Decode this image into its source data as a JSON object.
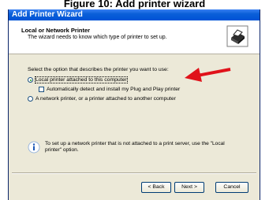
{
  "caption": "Figure 10: Add printer wizard",
  "window": {
    "title": "Add Printer Wizard"
  },
  "header": {
    "title": "Local or Network Printer",
    "subtitle": "The wizard needs to know which type of printer to set up.",
    "icon": "printer-icon"
  },
  "body": {
    "prompt": "Select the option that describes the printer you want to use:",
    "options": [
      {
        "label": "Local printer attached to this computer",
        "selected": true
      },
      {
        "label": "A network printer, or a printer attached to another computer",
        "selected": false
      }
    ],
    "auto_detect": {
      "label": "Automatically detect and install my Plug and Play printer",
      "checked": false
    },
    "info": {
      "icon": "info-icon",
      "text": "To set up a network printer that is not attached to a print server, use the \"Local printer\" option."
    }
  },
  "buttons": {
    "back": "< Back",
    "next": "Next >",
    "cancel": "Cancel"
  },
  "colors": {
    "title_bar": "#0a5fd8",
    "dialog_bg": "#ece9d8",
    "annotation_arrow": "#e0121a"
  }
}
